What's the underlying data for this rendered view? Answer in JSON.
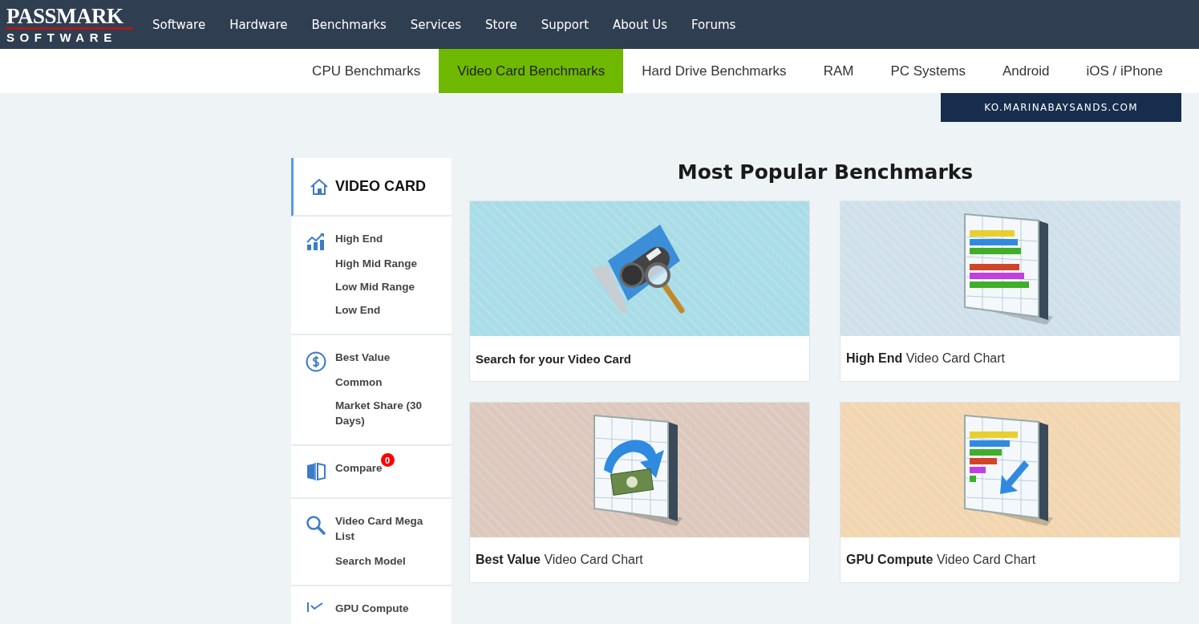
{
  "logo": {
    "title": "PASSMARK",
    "subtitle": "SOFTWARE"
  },
  "main_nav": [
    "Software",
    "Hardware",
    "Benchmarks",
    "Services",
    "Store",
    "Support",
    "About Us",
    "Forums"
  ],
  "sub_nav": [
    {
      "label": "CPU Benchmarks",
      "selected": false
    },
    {
      "label": "Video Card Benchmarks",
      "selected": true
    },
    {
      "label": "Hard Drive Benchmarks",
      "selected": false
    },
    {
      "label": "RAM",
      "selected": false
    },
    {
      "label": "PC Systems",
      "selected": false
    },
    {
      "label": "Android",
      "selected": false
    },
    {
      "label": "iOS / iPhone",
      "selected": false
    }
  ],
  "ad_banner": {
    "text": "KO.MARINABAYSANDS.COM"
  },
  "sidebar": {
    "header": {
      "title": "VIDEO CARD",
      "kind": "home"
    },
    "sections": [
      {
        "kind": "chart",
        "title": "High End",
        "items": [
          "High Mid Range",
          "Low Mid Range",
          "Low End"
        ]
      },
      {
        "kind": "dollar",
        "title": "Best Value",
        "items": [
          "Common",
          "Market Share (30 Days)"
        ]
      },
      {
        "kind": "compare",
        "title": "Compare",
        "badge": "0"
      },
      {
        "kind": "search",
        "title": "Video Card Mega List",
        "items": [
          "Search Model"
        ]
      },
      {
        "kind": "compute",
        "title": "GPU Compute"
      }
    ]
  },
  "heading": "Most Popular Benchmarks",
  "cards": [
    {
      "kind": "search",
      "caption": "Search for your Video Card"
    },
    {
      "kind": "high",
      "caption": "**High End** Video Card Chart"
    },
    {
      "kind": "value",
      "caption": "**Best Value** Video Card Chart"
    },
    {
      "kind": "compute",
      "caption": "**GPU Compute** Video Card Chart"
    }
  ]
}
